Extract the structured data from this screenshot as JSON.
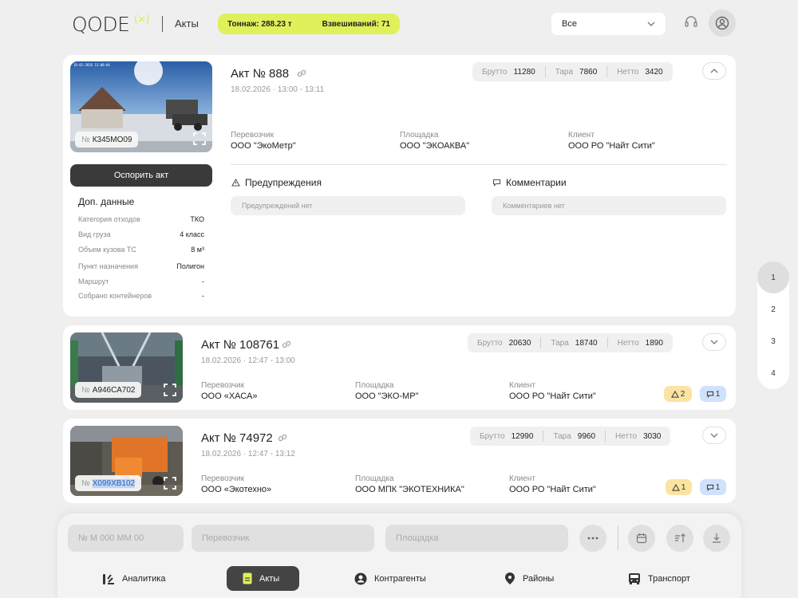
{
  "header": {
    "logo": "QODE",
    "logo_mark": "(×)",
    "title": "Акты",
    "tonnage": "Тоннаж: 288.23 т",
    "weighings": "Взвешиваний: 71",
    "filter_value": "Все"
  },
  "acts": [
    {
      "title": "Акт № 888",
      "date": "18.02.2026 · 13:00 - 13:11",
      "plate_prefix": "№",
      "plate": "К345МО09",
      "brutto_label": "Брутто",
      "brutto": "11280",
      "tara_label": "Тара",
      "tara": "7860",
      "netto_label": "Нетто",
      "netto": "3420",
      "carrier_label": "Перевозчик",
      "carrier": "ООО \"ЭкоМетр\"",
      "site_label": "Площадка",
      "site": "ООО \"ЭКОАКВА\"",
      "client_label": "Клиент",
      "client": "ООО РО \"Найт Сити\"",
      "photo_timestamp": "18-02-2026 13:00:04"
    },
    {
      "title": "Акт № 108761",
      "date": "18.02.2026 · 12:47 - 13:00",
      "plate_prefix": "№",
      "plate": "А946СА702",
      "brutto_label": "Брутто",
      "brutto": "20630",
      "tara_label": "Тара",
      "tara": "18740",
      "netto_label": "Нетто",
      "netto": "1890",
      "carrier_label": "Перевозчик",
      "carrier": "ООО «ХАСА»",
      "site_label": "Площадка",
      "site": "ООО \"ЭКО-МР\"",
      "client_label": "Клиент",
      "client": "ООО РО \"Найт Сити\"",
      "warnings": "2",
      "comments": "1"
    },
    {
      "title": "Акт № 74972",
      "date": "18.02.2026 · 12:47 - 13:12",
      "plate_prefix": "№",
      "plate": "Х099ХВ102",
      "brutto_label": "Брутто",
      "brutto": "12990",
      "tara_label": "Тара",
      "tara": "9960",
      "netto_label": "Нетто",
      "netto": "3030",
      "carrier_label": "Перевозчик",
      "carrier": "ООО «Экотехно»",
      "site_label": "Площадка",
      "site": "ООО МПК \"ЭКОТЕХНИКА\"",
      "client_label": "Клиент",
      "client": "ООО РО \"Найт Сити\"",
      "warnings": "1",
      "comments": "1"
    }
  ],
  "expanded": {
    "dispute_label": "Оспорить акт",
    "extra_title": "Доп. данные",
    "extra": [
      {
        "k": "Категория отходов",
        "v": "ТКО"
      },
      {
        "k": "Вид груза",
        "v": "4 класс"
      },
      {
        "k": "Объем кузова ТС",
        "v": "8 м³"
      },
      {
        "k": "Пункт назначения",
        "v": "Полигон"
      },
      {
        "k": "Маршрут",
        "v": "-"
      },
      {
        "k": "Собрано контейнеров",
        "v": "-"
      }
    ],
    "warnings_title": "Предупреждения",
    "warnings_empty": "Предупреждений нет",
    "comments_title": "Комментарии",
    "comments_empty": "Комментариев нет"
  },
  "pagination": [
    "1",
    "2",
    "3",
    "4"
  ],
  "filters": {
    "plate_placeholder": "№ М 000 ММ 00",
    "carrier_placeholder": "Перевозчик",
    "site_placeholder": "Площадка"
  },
  "nav": [
    {
      "label": "Аналитика",
      "icon": "analytics-icon"
    },
    {
      "label": "Акты",
      "icon": "acts-icon"
    },
    {
      "label": "Контрагенты",
      "icon": "contractors-icon"
    },
    {
      "label": "Районы",
      "icon": "location-pin-icon"
    },
    {
      "label": "Транспорт",
      "icon": "bus-icon"
    }
  ],
  "colors": {
    "accent": "#dff05a",
    "dark": "#3a3a3a",
    "warning": "#fbe3a2",
    "comment": "#cfe1fb"
  }
}
